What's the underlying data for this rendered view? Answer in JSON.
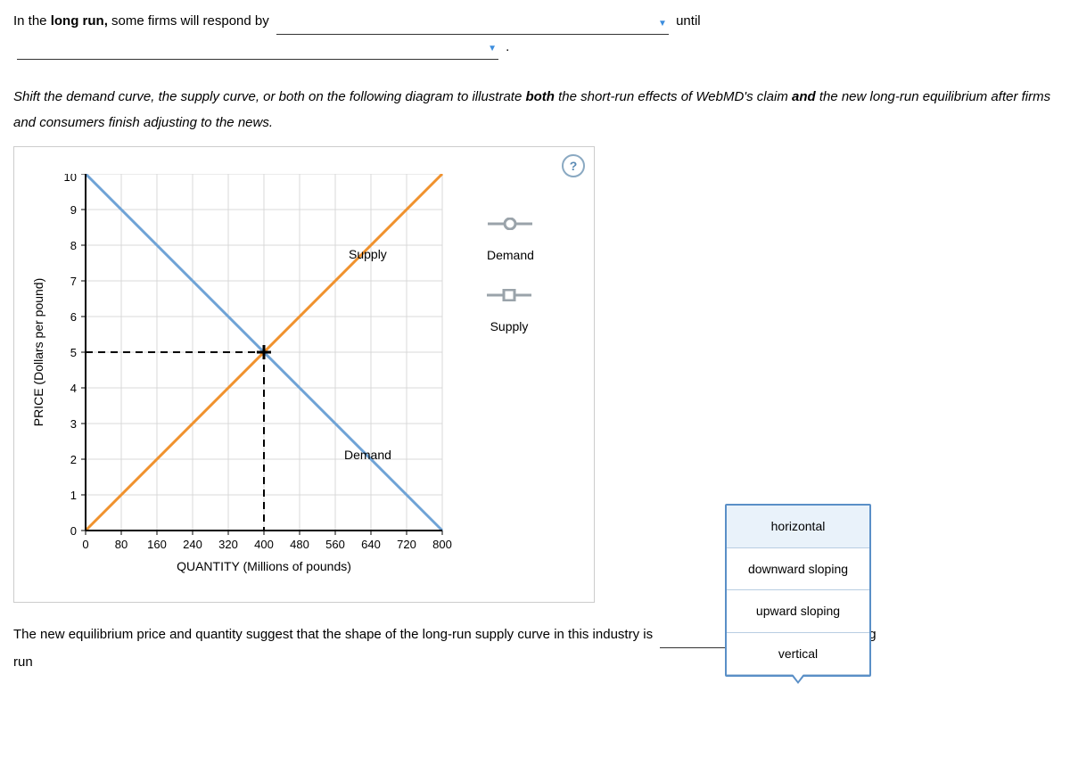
{
  "sentence1": {
    "prefix": "In the ",
    "bold1": "long run,",
    "mid": " some firms will respond by ",
    "until": " until",
    "period": " ."
  },
  "instruction": {
    "part1": "Shift the demand curve, the supply curve, or both on the following diagram to illustrate ",
    "bold1": "both",
    "part2": " the short-run effects of WebMD's claim ",
    "bold2": "and",
    "part3": " the new long-run equilibrium after firms and consumers finish adjusting to the news."
  },
  "help": "?",
  "chart": {
    "ylabel": "PRICE (Dollars per pound)",
    "xlabel": "QUANTITY (Millions of pounds)",
    "supply_label": "Supply",
    "demand_label": "Demand",
    "x_ticks": [
      "0",
      "80",
      "160",
      "240",
      "320",
      "400",
      "480",
      "560",
      "640",
      "720",
      "800"
    ],
    "y_ticks": [
      "0",
      "1",
      "2",
      "3",
      "4",
      "5",
      "6",
      "7",
      "8",
      "9",
      "10"
    ]
  },
  "legend": {
    "demand": "Demand",
    "supply": "Supply"
  },
  "dropdown_options": {
    "opt1": "horizontal",
    "opt2": "downward sloping",
    "opt3": "upward sloping",
    "opt4": "vertical"
  },
  "bottom": {
    "text1": "The new equilibrium price and quantity suggest that the shape of the long-run supply curve in this industry is ",
    "text2": " in the long",
    "run": "run"
  },
  "chart_data": {
    "type": "line",
    "xlabel": "QUANTITY (Millions of pounds)",
    "ylabel": "PRICE (Dollars per pound)",
    "xlim": [
      0,
      800
    ],
    "ylim": [
      0,
      10
    ],
    "series": [
      {
        "name": "Demand",
        "points": [
          [
            0,
            10
          ],
          [
            800,
            0
          ]
        ],
        "color": "#6fa3d6"
      },
      {
        "name": "Supply",
        "points": [
          [
            0,
            0
          ],
          [
            800,
            10
          ]
        ],
        "color": "#f0922e"
      }
    ],
    "equilibrium": {
      "x": 400,
      "y": 5
    },
    "guide_lines": [
      {
        "from": [
          0,
          5
        ],
        "to": [
          400,
          5
        ]
      },
      {
        "from": [
          400,
          0
        ],
        "to": [
          400,
          5
        ]
      }
    ]
  }
}
